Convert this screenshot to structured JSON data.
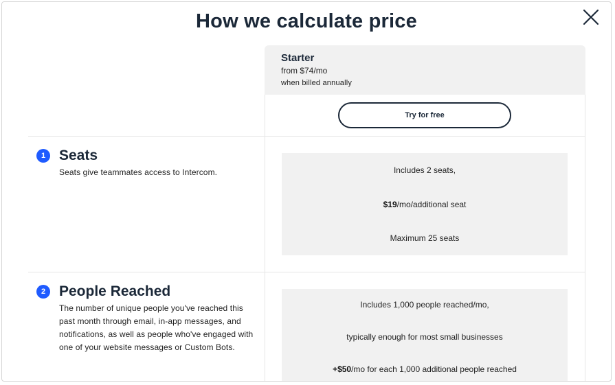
{
  "modal": {
    "title": "How we calculate price",
    "close_icon": "close-icon"
  },
  "plan": {
    "name": "Starter",
    "price": "from  $74/mo",
    "billing": "when billed annually",
    "cta_label": "Try for free"
  },
  "sections": [
    {
      "number": "1",
      "title": "Seats",
      "description": "Seats give teammates access to Intercom.",
      "lines": [
        {
          "bold": "",
          "text": "Includes 2 seats,"
        },
        {
          "bold": "$19",
          "text": "/mo/additional seat"
        },
        {
          "bold": "",
          "text": "Maximum 25 seats"
        }
      ]
    },
    {
      "number": "2",
      "title": "People Reached",
      "description": "The number of unique people you've reached this past month through email, in-app messages, and notifications, as well as people who've engaged with one of your website messages or Custom Bots.",
      "lines": [
        {
          "bold": "",
          "text": "Includes 1,000 people reached/mo,"
        },
        {
          "bold": "",
          "text": "typically enough for most small businesses"
        },
        {
          "bold": "+$50",
          "text": "/mo for each 1,000 additional people reached"
        }
      ]
    }
  ],
  "colors": {
    "accent": "#1f5bff",
    "heading": "#1b2838",
    "panel": "#f1f1f1"
  }
}
